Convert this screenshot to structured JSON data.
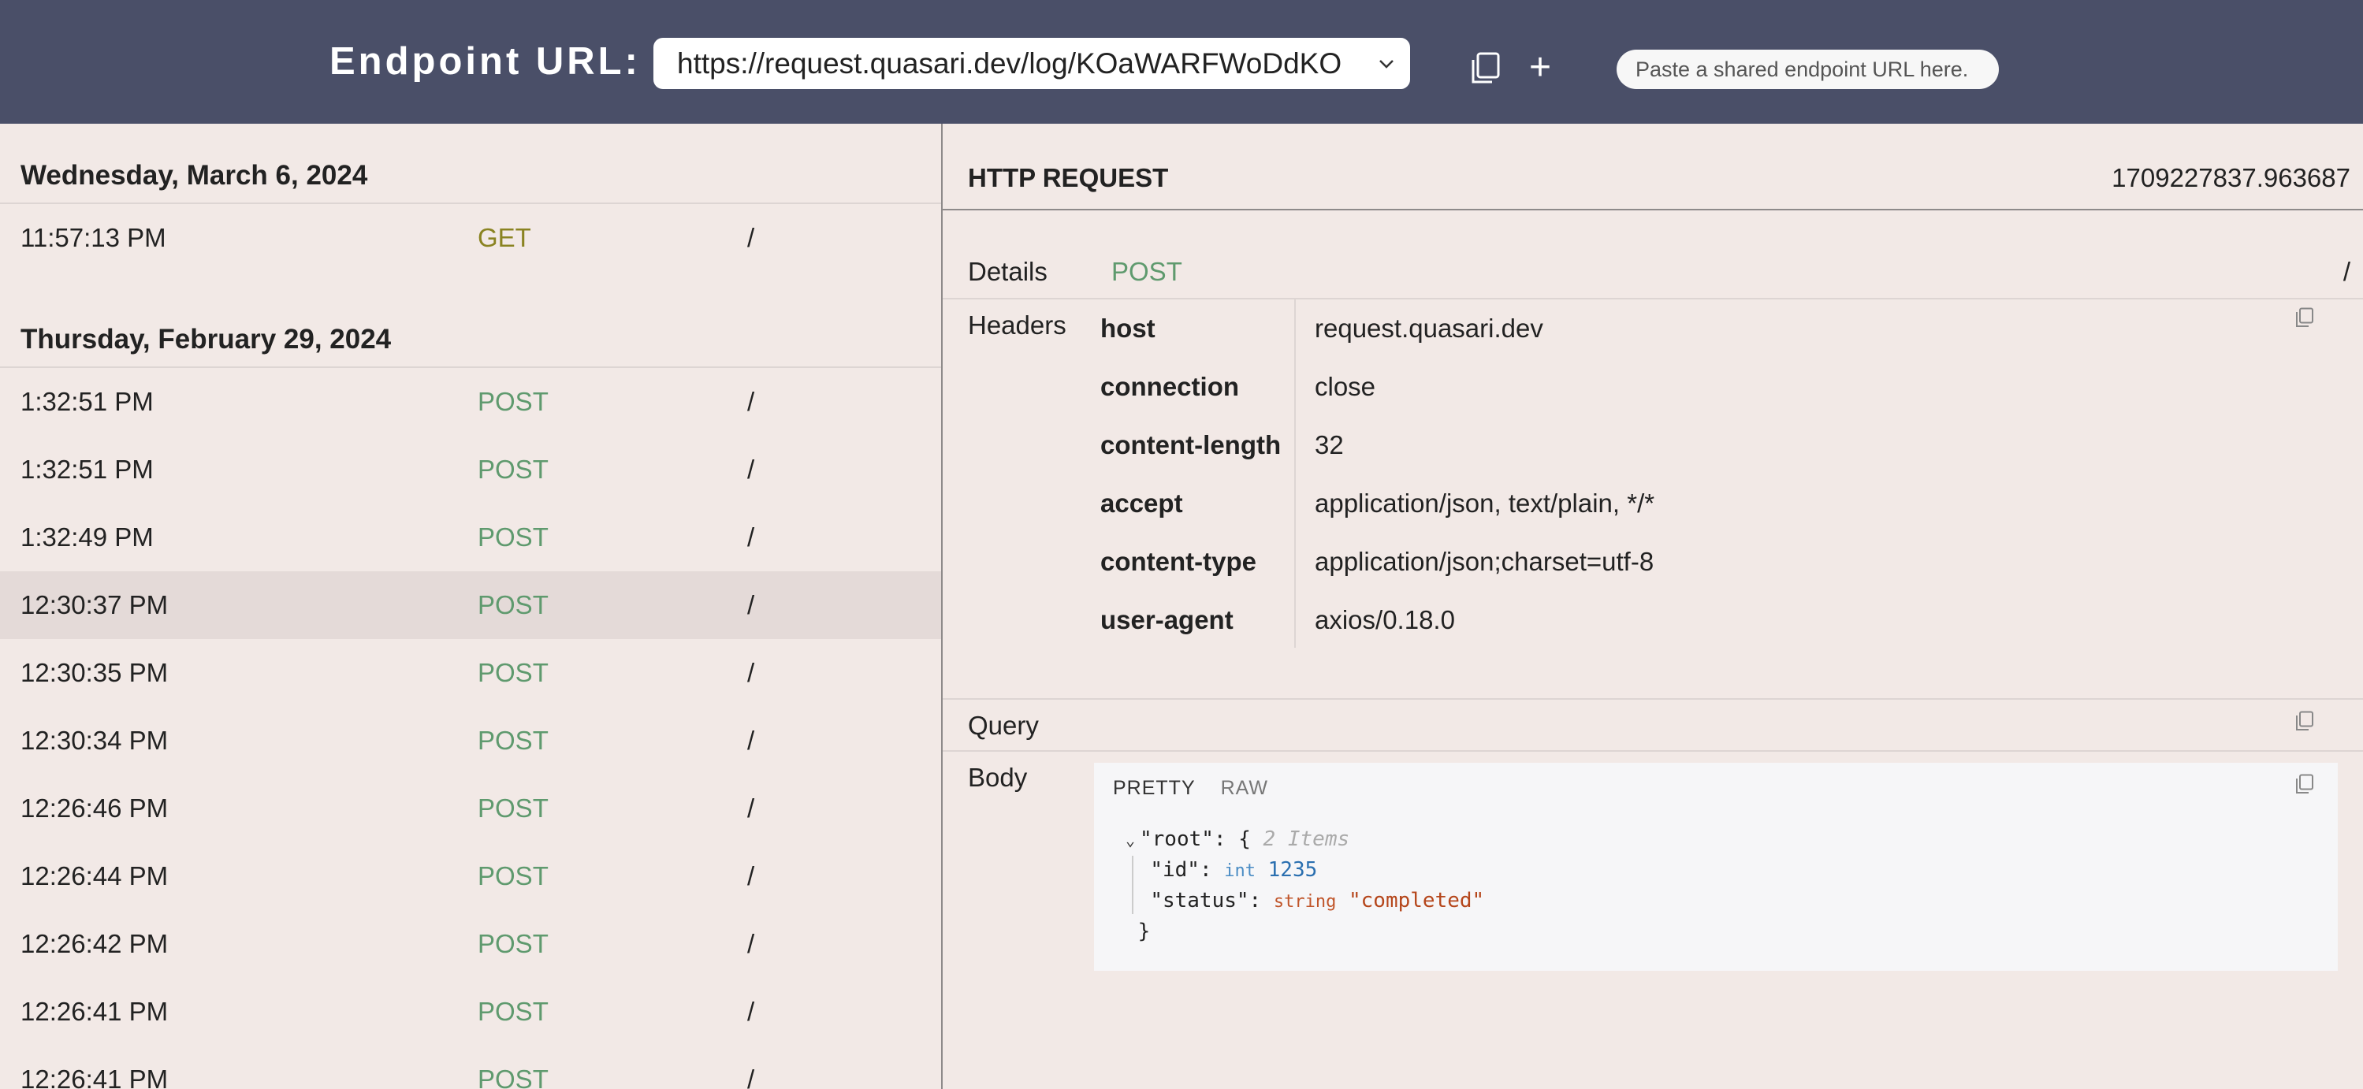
{
  "header": {
    "endpoint_label": "Endpoint URL:",
    "endpoint_url": "https://request.quasari.dev/log/KOaWARFWoDdKO",
    "paste_placeholder": "Paste a shared endpoint URL here.",
    "plus_label": "+"
  },
  "request_list": {
    "groups": [
      {
        "date": "Wednesday, March 6, 2024",
        "requests": [
          {
            "time": "11:57:13 PM",
            "method": "GET",
            "path": "/"
          }
        ]
      },
      {
        "date": "Thursday, February 29, 2024",
        "requests": [
          {
            "time": "1:32:51 PM",
            "method": "POST",
            "path": "/"
          },
          {
            "time": "1:32:51 PM",
            "method": "POST",
            "path": "/"
          },
          {
            "time": "1:32:49 PM",
            "method": "POST",
            "path": "/"
          },
          {
            "time": "12:30:37 PM",
            "method": "POST",
            "path": "/"
          },
          {
            "time": "12:30:35 PM",
            "method": "POST",
            "path": "/"
          },
          {
            "time": "12:30:34 PM",
            "method": "POST",
            "path": "/"
          },
          {
            "time": "12:26:46 PM",
            "method": "POST",
            "path": "/"
          },
          {
            "time": "12:26:44 PM",
            "method": "POST",
            "path": "/"
          },
          {
            "time": "12:26:42 PM",
            "method": "POST",
            "path": "/"
          },
          {
            "time": "12:26:41 PM",
            "method": "POST",
            "path": "/"
          },
          {
            "time": "12:26:41 PM",
            "method": "POST",
            "path": "/"
          }
        ]
      }
    ]
  },
  "detail": {
    "title": "HTTP REQUEST",
    "timestamp": "1709227837.963687",
    "details_label": "Details",
    "method": "POST",
    "path": "/",
    "headers_label": "Headers",
    "headers": [
      {
        "key": "host",
        "value": "request.quasari.dev"
      },
      {
        "key": "connection",
        "value": "close"
      },
      {
        "key": "content-length",
        "value": "32"
      },
      {
        "key": "accept",
        "value": "application/json, text/plain, */*"
      },
      {
        "key": "content-type",
        "value": "application/json;charset=utf-8"
      },
      {
        "key": "user-agent",
        "value": "axios/0.18.0"
      }
    ],
    "query_label": "Query",
    "body_label": "Body",
    "body_tabs": {
      "pretty": "PRETTY",
      "raw": "RAW"
    },
    "json_view": {
      "root_key": "\"root\"",
      "root_open": "{",
      "root_meta": "2 Items",
      "fields": [
        {
          "key": "\"id\"",
          "type": "int",
          "value": "1235"
        },
        {
          "key": "\"status\"",
          "type": "string",
          "value": "\"completed\""
        }
      ],
      "root_close": "}"
    }
  },
  "colors": {
    "topbar": "#4a4f68",
    "background": "#f2e9e6",
    "selected_row": "#e4dad8",
    "get_method": "#8a8321",
    "post_method": "#5f9a6e"
  }
}
